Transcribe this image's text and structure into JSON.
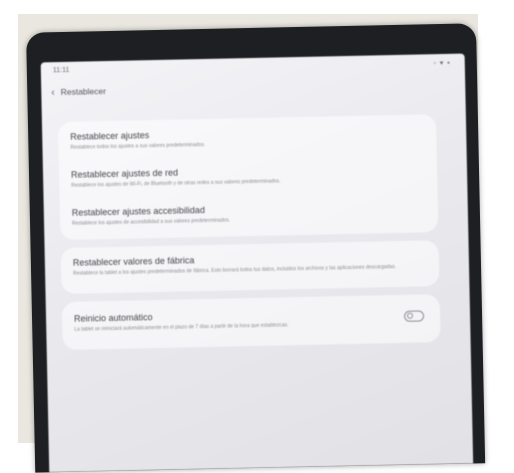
{
  "status_bar": {
    "time": "11:11",
    "icons": "◦ ▾ ▪"
  },
  "header": {
    "title": "Restablecer"
  },
  "items": [
    {
      "title": "Restablecer ajustes",
      "description": "Restablece todos los ajustes a sus valores predeterminados."
    },
    {
      "title": "Restablecer ajustes de red",
      "description": "Restablece los ajustes de Wi-Fi, de Bluetooth y de otras redes a sus valores predeterminados."
    },
    {
      "title": "Restablecer ajustes accesibilidad",
      "description": "Restablece los ajustes de accesibilidad a sus valores predeterminados."
    },
    {
      "title": "Restablecer valores de fábrica",
      "description": "Restablece la tablet a los ajustes predeterminados de fábrica. Esto borrará todos tus datos, incluidos los archivos y las aplicaciones descargadas."
    },
    {
      "title": "Reinicio automático",
      "description": "La tablet se reiniciará automáticamente en el plazo de 7 días a partir de la hora que establezcas."
    }
  ],
  "auto_restart": {
    "enabled": false
  }
}
